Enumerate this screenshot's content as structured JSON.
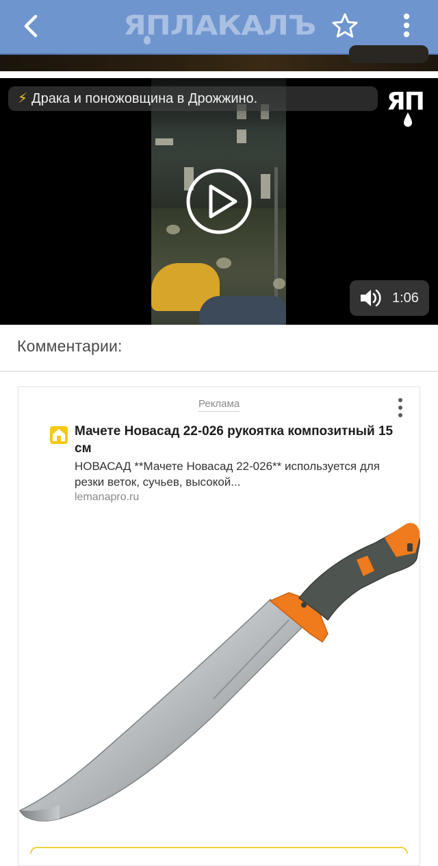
{
  "header": {
    "logo_text": "ЯПЛАКАЛЪ",
    "back_icon": "chevron-left-icon",
    "favorite_icon": "star-outline-icon",
    "menu_icon": "more-vertical-icon",
    "bar_color": "#6f95cf"
  },
  "video": {
    "title_icon": "⚡",
    "title": "Драка и поножовщина в Дрожжино.",
    "watermark_text": "ЯП",
    "duration": "1:06",
    "play_icon": "play-icon",
    "volume_icon": "volume-icon"
  },
  "comments": {
    "heading": "Комментарии:"
  },
  "ad": {
    "label": "Реклама",
    "title": "Мачете Новасад 22-026 рукоятка композитный 15 см",
    "description": "НОВАСАД **Мачете Новасад 22-026** используется для резки веток, сучьев, высокой...",
    "domain": "lemanapro.ru",
    "image": "machete-product-image",
    "accent_color": "#f07b1c"
  }
}
